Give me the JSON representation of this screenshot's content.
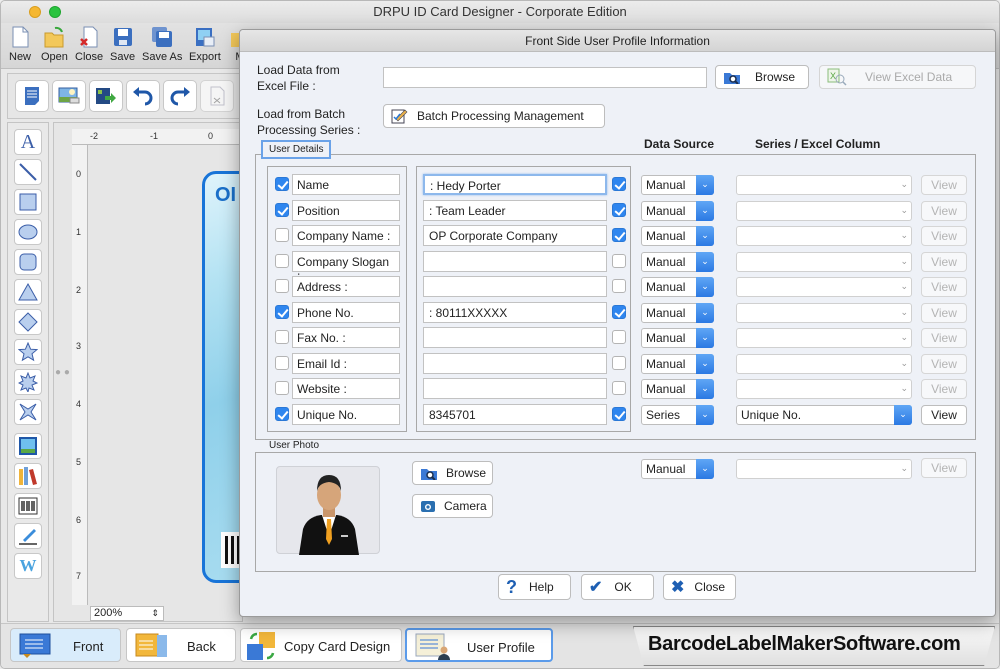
{
  "window": {
    "title": "DRPU ID Card Designer - Corporate Edition"
  },
  "toolbar": {
    "items": [
      {
        "label": "New",
        "icon": "new-document-icon"
      },
      {
        "label": "Open",
        "icon": "open-folder-icon"
      },
      {
        "label": "Close",
        "icon": "close-document-icon"
      },
      {
        "label": "Save",
        "icon": "save-icon"
      },
      {
        "label": "Save As",
        "icon": "save-as-icon"
      },
      {
        "label": "Export",
        "icon": "export-icon"
      },
      {
        "label": "M",
        "icon": "mail-icon"
      }
    ]
  },
  "secondary_toolbar": {
    "items": [
      "page-properties-icon",
      "background-image-icon",
      "export-image-icon",
      "undo-icon",
      "redo-icon",
      "cut-icon"
    ]
  },
  "drawing_tools": [
    "text-tool-icon",
    "line-tool-icon",
    "rectangle-tool-icon",
    "ellipse-tool-icon",
    "rounded-rectangle-tool-icon",
    "triangle-tool-icon",
    "diamond-tool-icon",
    "star-tool-icon",
    "burst-tool-icon",
    "four-point-star-tool-icon",
    "image-tool-icon",
    "library-tool-icon",
    "barcode-tool-icon",
    "signature-tool-icon",
    "watermark-tool-icon"
  ],
  "canvas": {
    "ruler_h": [
      "-2",
      "-1",
      "0"
    ],
    "ruler_v": [
      "0",
      "1",
      "2",
      "3",
      "4",
      "5",
      "6",
      "7"
    ],
    "zoom_level": "200%",
    "card_title_partial": "OI"
  },
  "bottom_tabs": [
    {
      "label": "Front"
    },
    {
      "label": "Back"
    },
    {
      "label": "Copy Card Design"
    },
    {
      "label": "User Profile"
    }
  ],
  "brand": "BarcodeLabelMakerSoftware.com",
  "dialog": {
    "title": "Front Side User Profile Information",
    "excel_label": "Load Data from\nExcel File :",
    "excel_label_line1": "Load Data from",
    "excel_label_line2": "Excel File :",
    "excel_file_value": "",
    "browse_label": "Browse",
    "view_excel_label": "View Excel Data",
    "batch_label_line1": "Load from Batch",
    "batch_label_line2": "Processing Series :",
    "batch_button_label": "Batch Processing Management",
    "user_details_title": "User Details",
    "data_source_header": "Data Source",
    "series_column_header": "Series / Excel Column",
    "rows": [
      {
        "checked": true,
        "label": "Name",
        "value": ": Hedy Porter",
        "value_checked": true,
        "source": "Manual",
        "column": "",
        "view": "View",
        "view_enabled": false
      },
      {
        "checked": true,
        "label": "Position",
        "value": ": Team Leader",
        "value_checked": true,
        "source": "Manual",
        "column": "",
        "view": "View",
        "view_enabled": false
      },
      {
        "checked": false,
        "label": "Company Name :",
        "value": "OP Corporate Company",
        "value_checked": true,
        "source": "Manual",
        "column": "",
        "view": "View",
        "view_enabled": false
      },
      {
        "checked": false,
        "label": "Company Slogan :",
        "value": "",
        "value_checked": false,
        "source": "Manual",
        "column": "",
        "view": "View",
        "view_enabled": false
      },
      {
        "checked": false,
        "label": "Address :",
        "value": "",
        "value_checked": false,
        "source": "Manual",
        "column": "",
        "view": "View",
        "view_enabled": false
      },
      {
        "checked": true,
        "label": "Phone No.",
        "value": ": 80111XXXXX",
        "value_checked": true,
        "source": "Manual",
        "column": "",
        "view": "View",
        "view_enabled": false
      },
      {
        "checked": false,
        "label": "Fax No. :",
        "value": "",
        "value_checked": false,
        "source": "Manual",
        "column": "",
        "view": "View",
        "view_enabled": false
      },
      {
        "checked": false,
        "label": "Email Id :",
        "value": "",
        "value_checked": false,
        "source": "Manual",
        "column": "",
        "view": "View",
        "view_enabled": false
      },
      {
        "checked": false,
        "label": "Website :",
        "value": "",
        "value_checked": false,
        "source": "Manual",
        "column": "",
        "view": "View",
        "view_enabled": false
      },
      {
        "checked": true,
        "label": "Unique No.",
        "value": "8345701",
        "value_checked": true,
        "source": "Series",
        "column": "Unique No.",
        "view": "View",
        "view_enabled": true
      }
    ],
    "user_photo_title": "User Photo",
    "photo_browse_label": "Browse",
    "camera_label": "Camera",
    "photo_source": "Manual",
    "photo_column": "",
    "photo_view": "View",
    "help_label": "Help",
    "ok_label": "OK",
    "close_label": "Close"
  }
}
